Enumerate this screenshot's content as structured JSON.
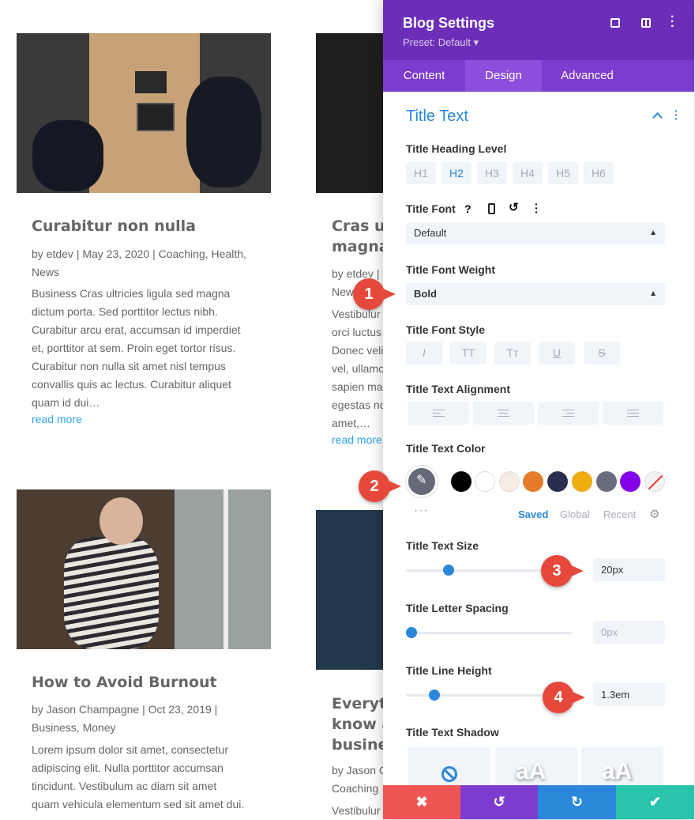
{
  "posts": [
    {
      "title": "Curabitur non nulla",
      "meta_line1": "by etdev | May 23, 2020 | Coaching, Health,",
      "meta_line2": "News",
      "excerpt": [
        "Business Cras ultricies ligula sed magna",
        "dictum porta. Sed porttitor lectus nibh.",
        "Curabitur arcu erat, accumsan id imperdiet",
        "et, porttitor at sem. Proin eget tortor risus.",
        "Curabitur non nulla sit amet nisl tempus",
        "convallis quis ac lectus. Curabitur aliquet",
        "quam id dui…"
      ],
      "read_more": "read more"
    },
    {
      "title_line1": "Cras ul",
      "title_line2": "magna",
      "meta": "by etdev |",
      "meta2": "New",
      "excerpt": [
        "Vestibulur",
        "orci luctus",
        "Donec veli",
        "vel, ullamc",
        "sapien ma",
        "egestas no",
        "amet,…"
      ],
      "read_more": "read more"
    },
    {
      "title": "How to Avoid Burnout",
      "meta_line1": "by Jason Champagne | Oct 23, 2019 |",
      "meta_line2": "Business, Money",
      "excerpt": [
        "Lorem ipsum dolor sit amet, consectetur",
        "adipiscing elit. Nulla porttitor accumsan",
        "tincidunt. Vestibulum ac diam sit amet",
        "quam vehicula elementum sed sit amet dui."
      ]
    },
    {
      "title_line1": "Everytl",
      "title_line2": "know a",
      "title_line3": "busine",
      "meta": "by Jason C",
      "meta2": "Coaching",
      "excerpt": [
        "Vestibulur"
      ]
    }
  ],
  "panel": {
    "title": "Blog Settings",
    "preset": "Preset: Default ▾",
    "tabs": [
      "Content",
      "Design",
      "Advanced"
    ],
    "active_tab": "Design",
    "section": "Title Text",
    "heading_level_label": "Title Heading Level",
    "heading_levels": [
      "H1",
      "H2",
      "H3",
      "H4",
      "H5",
      "H6"
    ],
    "font_label": "Title Font",
    "font_value": "Default",
    "weight_label": "Title Font Weight",
    "weight_value": "Bold",
    "style_label": "Title Font Style",
    "style_buttons": [
      "I",
      "TT",
      "Tт",
      "U",
      "S"
    ],
    "align_label": "Title Text Alignment",
    "color_label": "Title Text Color",
    "swatch_tabs": [
      "Saved",
      "Global",
      "Recent"
    ],
    "size_label": "Title Text Size",
    "size_value": "20px",
    "size_level": 0.24,
    "spacing_label": "Title Letter Spacing",
    "spacing_value": "0px",
    "spacing_level": 0,
    "lineheight_label": "Title Line Height",
    "lineheight_value": "1.3em",
    "lineheight_level": 0.15,
    "shadow_label": "Title Text Shadow",
    "shadow_preview": "aA",
    "callouts": [
      "1",
      "2",
      "3",
      "4"
    ]
  },
  "colors": {
    "header": "#6c2eb9",
    "tabs": "#7d3bcf",
    "accent": "#2b87da",
    "cancel": "#ef5555",
    "undo": "#7e3bd0",
    "redo": "#2b87da",
    "save": "#29c4a9"
  },
  "swatches": [
    "#000000",
    "#ffffff",
    "#f5ede4",
    "#e67c2a",
    "#2b2d4e",
    "#f0ad10",
    "#6b6b80",
    "#8300e9"
  ]
}
